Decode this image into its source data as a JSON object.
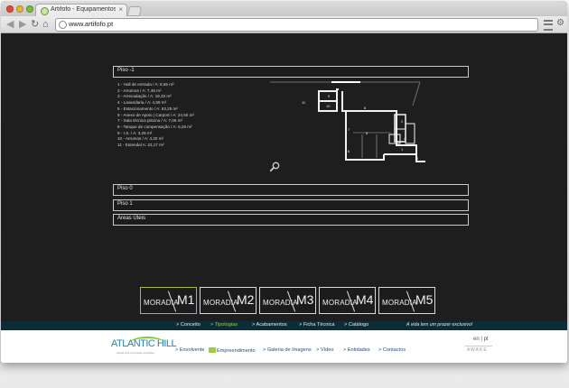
{
  "browser": {
    "tab_title": "Artifofo - Equipamentos ...",
    "tab_close": "×",
    "url": "www.artifofo.pt"
  },
  "floors": [
    {
      "label": "Piso -1"
    },
    {
      "label": "Piso 0"
    },
    {
      "label": "Piso 1"
    },
    {
      "label": "Áreas Úteis"
    }
  ],
  "rooms": [
    "1 - Hall de entrada / A: 8,65 m²",
    "2 - Arrumos / A: 7,46 m²",
    "3 - Arrecadação / A: 19,33 m²",
    "4 - Lavandaria / A: 4,68 m²",
    "5 - Estacionamento / A: 63,25 m²",
    "6 - Anexo de Apoio | Carport / A: 24,50 m²",
    "7 - Sala técnica piscina / A: 7,06 m²",
    "8 - Tanque de compensação / A: 6,26 m²",
    "9 - I.S. / A: 3,26 m²",
    "10 - Arrumos / A: 4,20 m²",
    "11 - Estendal A: 23,17 m²"
  ],
  "plan_labels": [
    "11",
    "9",
    "10",
    "8",
    "7",
    "6",
    "5",
    "2",
    "4",
    "1",
    "3"
  ],
  "models": [
    {
      "label": "MORADIA",
      "num": "M1",
      "active": true
    },
    {
      "label": "MORADIA",
      "num": "M2",
      "active": false
    },
    {
      "label": "MORADIA",
      "num": "M3",
      "active": false
    },
    {
      "label": "MORADIA",
      "num": "M4",
      "active": false
    },
    {
      "label": "MORADIA",
      "num": "M5",
      "active": false
    }
  ],
  "subnav": {
    "items": [
      "> Conceito",
      "> Tipologias",
      "> Acabamentos",
      "> Ficha Técnica",
      "> Catálogo"
    ],
    "tagline": "A vida tem um prazer exclusivo!"
  },
  "footer": {
    "logo": "ATLANTIC HILL",
    "logo_sub": "prazer tem um prazer exclusivo",
    "nav": [
      "> Envolvente",
      "Empreendimento",
      "> Galeria de Imagens",
      "> Vídeo",
      "> Entidades",
      "> Contactos"
    ],
    "lang": "en | pt",
    "awake": "AWAKE"
  },
  "colors": {
    "accent": "#9fcf3a",
    "subnav_bg": "#0b2d38",
    "page_bg": "#1e1e1e"
  },
  "icons": [
    "search-zoom-icon",
    "back-arrow-icon",
    "forward-arrow-icon",
    "reload-icon",
    "home-icon",
    "globe-icon",
    "wrench-icon"
  ]
}
